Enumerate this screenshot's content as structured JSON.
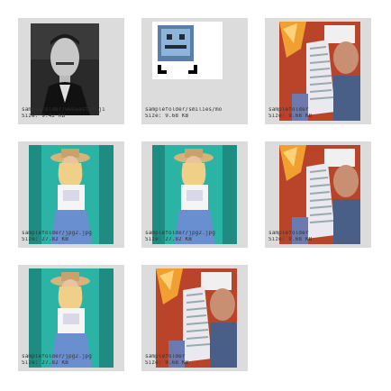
{
  "gallery": {
    "items": [
      {
        "kind": "portrait",
        "name": "samplefolder/wwswaster.ji",
        "size": "Size: 9.42 KB",
        "icon": "portrait-photo"
      },
      {
        "kind": "smiley",
        "name": "samplefolder/smilies/mo",
        "size": "Size: 9.68 KB",
        "icon": "pixel-smiley"
      },
      {
        "kind": "fire",
        "name": "samplefolder",
        "size": "Size: 9.68 KB",
        "icon": "fire-photo"
      },
      {
        "kind": "woman",
        "name": "samplefolder/jpg2.jpg",
        "size": "Size: 27.82 KB",
        "icon": "woman-hat-photo"
      },
      {
        "kind": "woman",
        "name": "samplefolder/jpg2.jpg",
        "size": "Size: 27.82 KB",
        "icon": "woman-hat-photo"
      },
      {
        "kind": "fire",
        "name": "samplefolder",
        "size": "Size: 9.68 KB",
        "icon": "fire-photo"
      },
      {
        "kind": "woman",
        "name": "samplefolder/jpg2.jpg",
        "size": "Size: 27.82 KB",
        "icon": "woman-hat-photo"
      },
      {
        "kind": "fire",
        "name": "samplefolder",
        "size": "Size: 9.68 KB",
        "icon": "fire-photo"
      }
    ]
  }
}
